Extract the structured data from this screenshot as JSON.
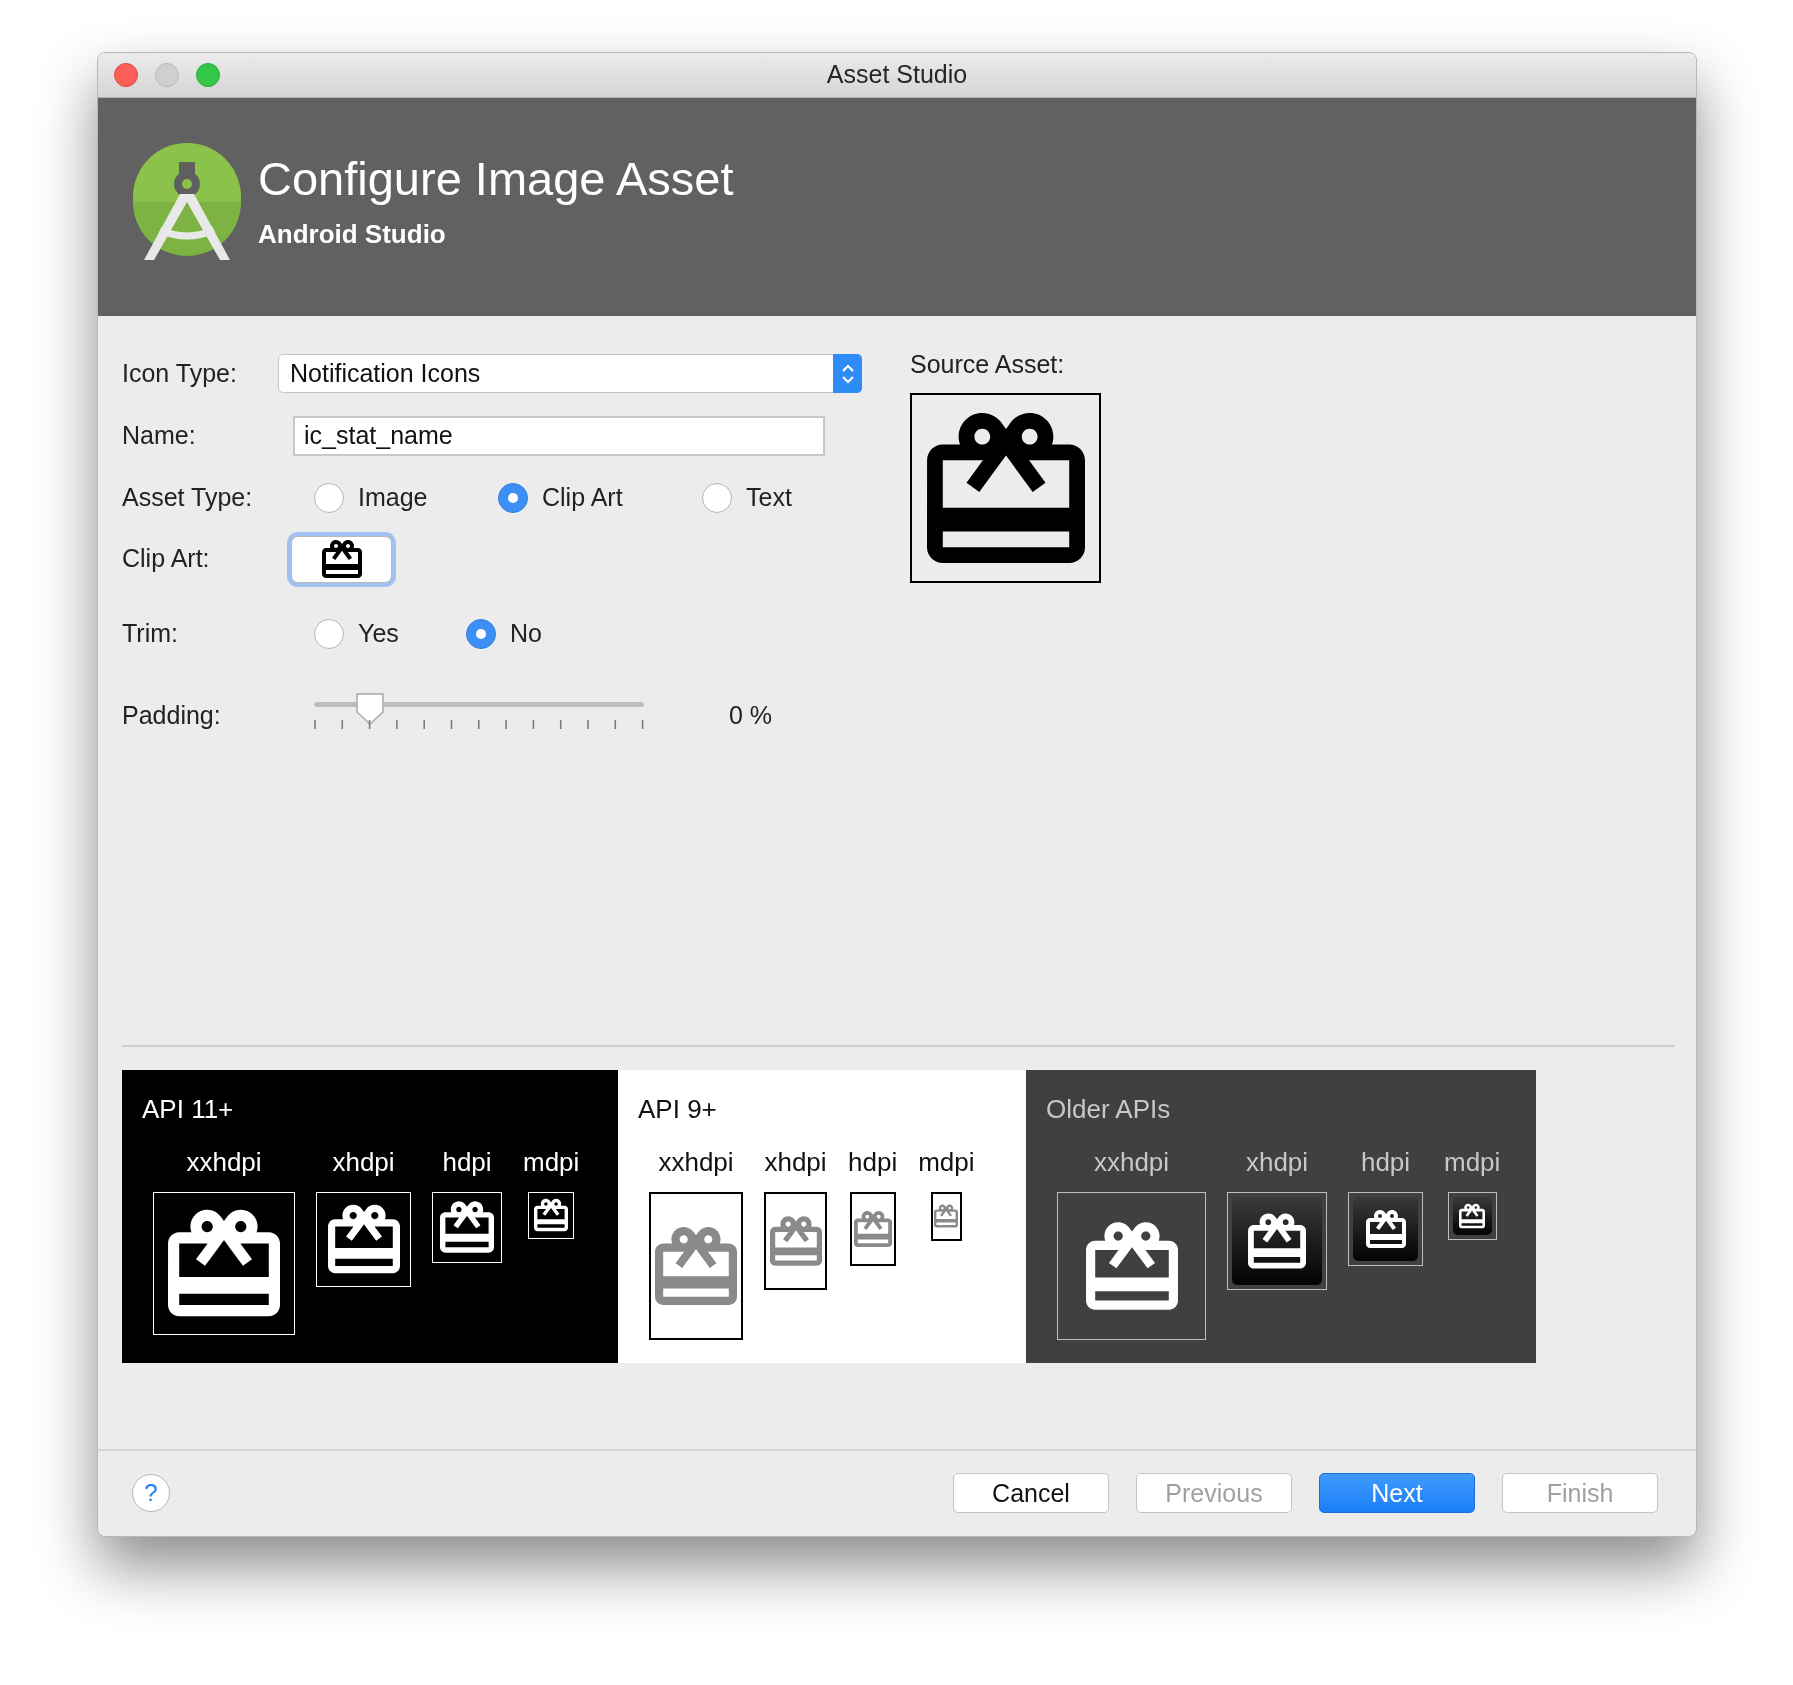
{
  "window": {
    "title": "Asset Studio"
  },
  "header": {
    "title": "Configure Image Asset",
    "subtitle": "Android Studio"
  },
  "form": {
    "icon_type": {
      "label": "Icon Type:",
      "value": "Notification Icons"
    },
    "name": {
      "label": "Name:",
      "value": "ic_stat_name"
    },
    "asset_type": {
      "label": "Asset Type:",
      "options": [
        {
          "label": "Image",
          "selected": false
        },
        {
          "label": "Clip Art",
          "selected": true
        },
        {
          "label": "Text",
          "selected": false
        }
      ]
    },
    "clip_art": {
      "label": "Clip Art:"
    },
    "trim": {
      "label": "Trim:",
      "options": [
        {
          "label": "Yes",
          "selected": false
        },
        {
          "label": "No",
          "selected": true
        }
      ]
    },
    "padding": {
      "label": "Padding:",
      "level": 0.17,
      "reading": "0 %"
    }
  },
  "source_asset": {
    "label": "Source Asset:"
  },
  "previews": [
    {
      "title": "API 11+",
      "kind": "dark",
      "densities": [
        "xxhdpi",
        "xhdpi",
        "hdpi",
        "mdpi"
      ]
    },
    {
      "title": "API 9+",
      "kind": "light",
      "densities": [
        "xxhdpi",
        "xhdpi",
        "hdpi",
        "mdpi"
      ]
    },
    {
      "title": "Older APIs",
      "kind": "gray",
      "densities": [
        "xxhdpi",
        "xhdpi",
        "hdpi",
        "mdpi"
      ]
    }
  ],
  "footer": {
    "help": "?",
    "buttons": [
      {
        "label": "Cancel",
        "disabled": false,
        "default": false
      },
      {
        "label": "Previous",
        "disabled": true,
        "default": false
      },
      {
        "label": "Next",
        "disabled": false,
        "default": true
      },
      {
        "label": "Finish",
        "disabled": true,
        "default": false
      }
    ]
  }
}
